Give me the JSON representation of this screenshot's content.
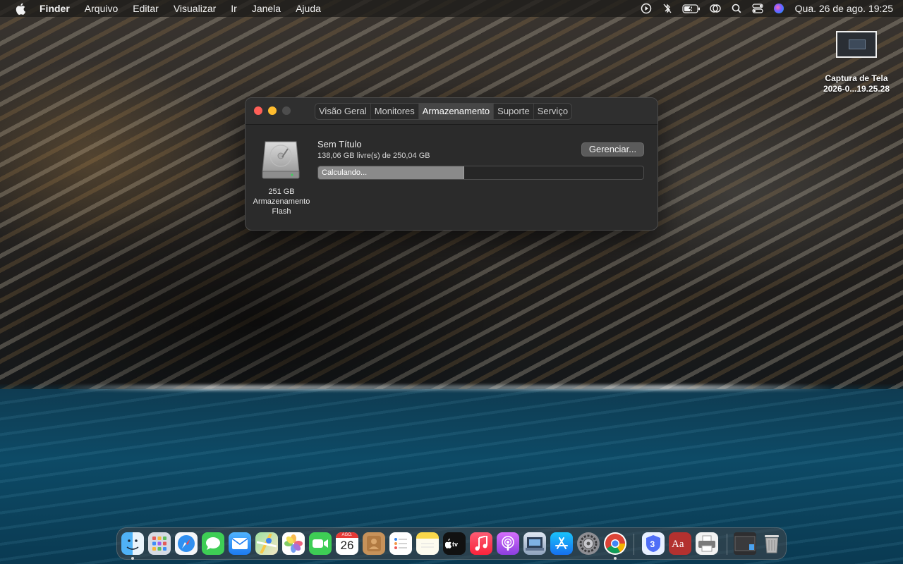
{
  "menubar": {
    "app_name": "Finder",
    "menus": [
      "Arquivo",
      "Editar",
      "Visualizar",
      "Ir",
      "Janela",
      "Ajuda"
    ],
    "clock": "Qua. 26 de ago.  19:25",
    "status_icons": [
      "play-circle-icon",
      "bluetooth-off-icon",
      "battery-charging-icon",
      "screen-mirroring-icon",
      "spotlight-search-icon",
      "control-center-icon",
      "siri-icon"
    ]
  },
  "desktop": {
    "file_name_line1": "Captura de Tela",
    "file_name_line2": "2026-0...19.25.28"
  },
  "window": {
    "tabs": [
      "Visão Geral",
      "Monitores",
      "Armazenamento",
      "Suporte",
      "Serviço"
    ],
    "active_tab": "Armazenamento",
    "disk": {
      "size": "251 GB",
      "type_line1": "Armazenamento",
      "type_line2": "Flash"
    },
    "volume": {
      "name": "Sem Título",
      "free": "138,06 GB livre(s) de 250,04 GB",
      "bar_label": "Calculando...",
      "used_fraction": 0.448
    },
    "manage_button": "Gerenciar..."
  },
  "dock": {
    "apps": [
      "Finder",
      "Launchpad",
      "Safari",
      "Mensagens",
      "Mail",
      "Mapas",
      "Fotos",
      "FaceTime",
      "Calendário",
      "Contatos",
      "Lembretes",
      "Notas",
      "TV",
      "Música",
      "Podcasts",
      "Pré-Visualização",
      "App Store",
      "Ajustes do Sistema",
      "Google Chrome",
      "3",
      "Dicionário",
      "Impressora",
      "Captura de Tela",
      "Lixo"
    ],
    "calendar": {
      "month": "AGO.",
      "day": "26"
    }
  },
  "colors": {
    "close": "#fe5f57",
    "minimize": "#febc2e",
    "window_bg": "#2b2b2b",
    "bar_fill": "#8a8a8a"
  }
}
